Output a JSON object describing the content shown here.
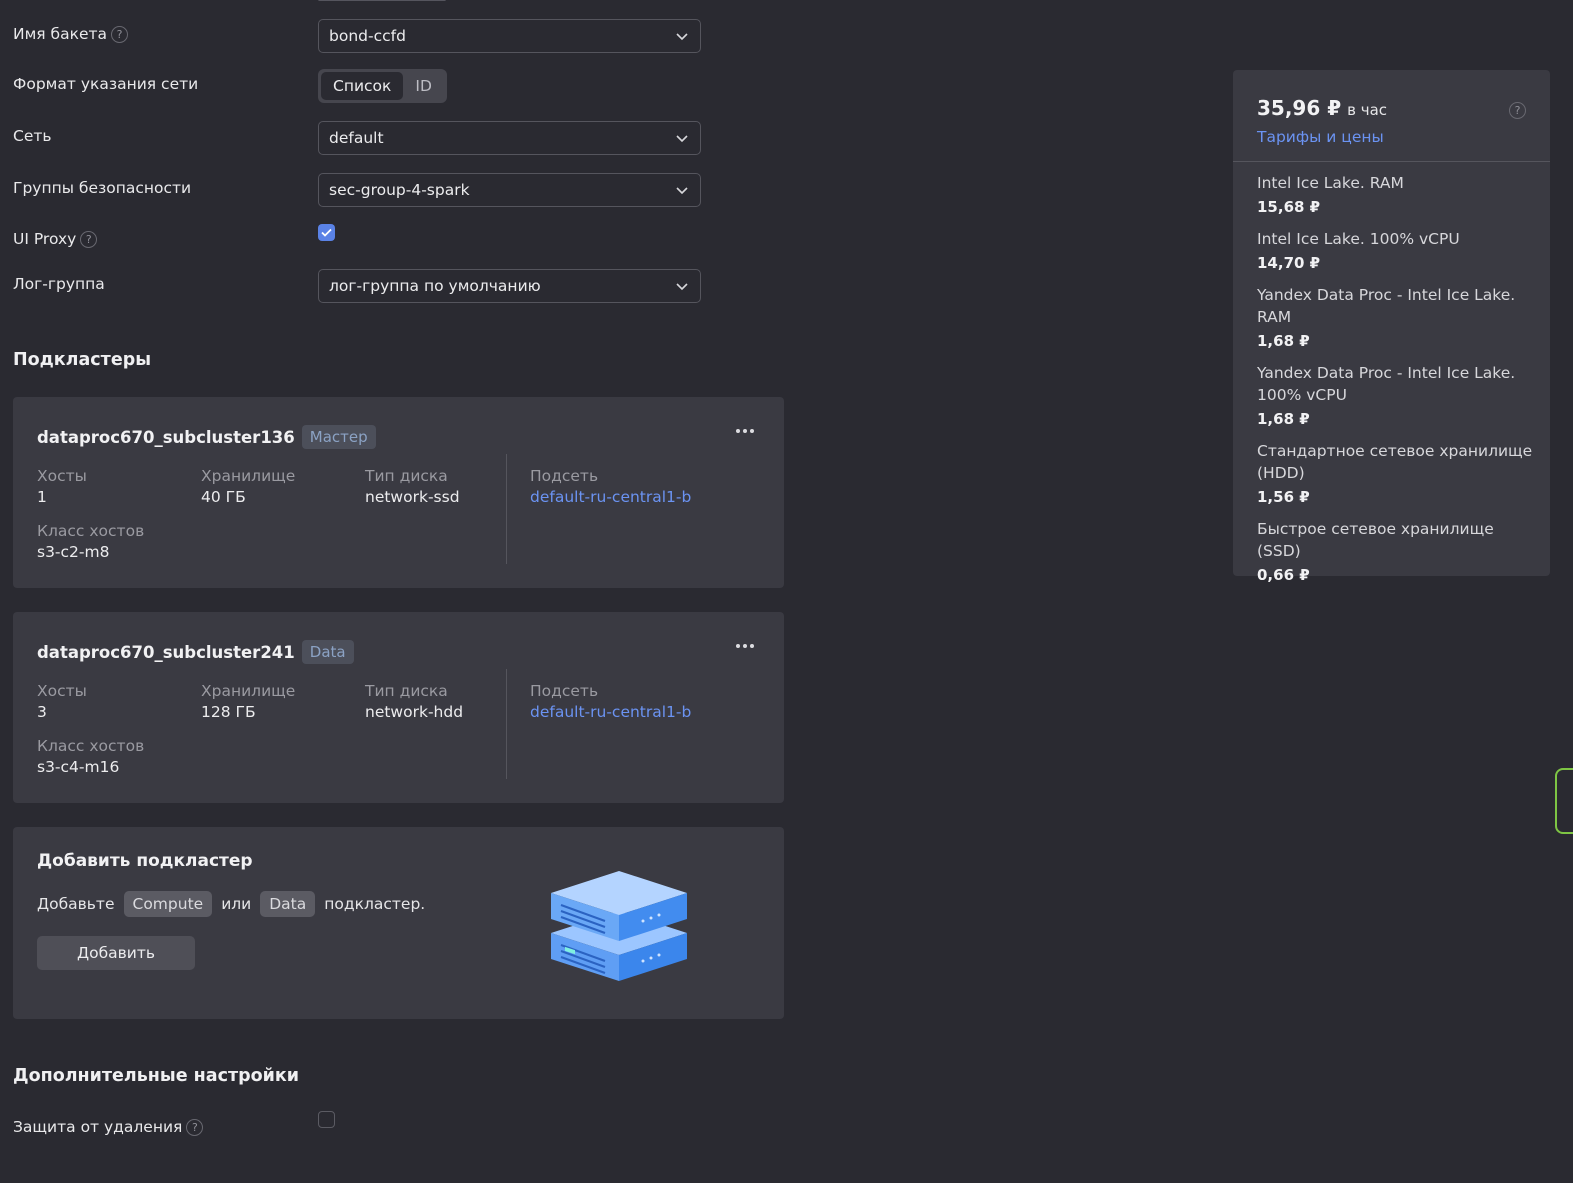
{
  "form": {
    "bucket": {
      "label": "Имя бакета",
      "value": "bond-ccfd"
    },
    "network_format": {
      "label": "Формат указания сети",
      "options": [
        "Список",
        "ID"
      ],
      "selected": "Список"
    },
    "network": {
      "label": "Сеть",
      "value": "default"
    },
    "security_groups": {
      "label": "Группы безопасности",
      "value": "sec-group-4-spark"
    },
    "ui_proxy": {
      "label": "UI Proxy",
      "checked": true
    },
    "log_group": {
      "label": "Лог-группа",
      "value": "лог-группа по умолчанию"
    }
  },
  "subclusters": {
    "title": "Подкластеры",
    "items": [
      {
        "name": "dataproc670_subcluster136",
        "role": "Мастер",
        "hosts_label": "Хосты",
        "hosts": "1",
        "storage_label": "Хранилище",
        "storage": "40 ГБ",
        "disk_label": "Тип диска",
        "disk": "network-ssd",
        "subnet_label": "Подсеть",
        "subnet": "default-ru-central1-b",
        "class_label": "Класс хостов",
        "class": "s3-c2-m8"
      },
      {
        "name": "dataproc670_subcluster241",
        "role": "Data",
        "hosts_label": "Хосты",
        "hosts": "3",
        "storage_label": "Хранилище",
        "storage": "128 ГБ",
        "disk_label": "Тип диска",
        "disk": "network-hdd",
        "subnet_label": "Подсеть",
        "subnet": "default-ru-central1-b",
        "class_label": "Класс хостов",
        "class": "s3-c4-m16"
      }
    ],
    "add": {
      "title": "Добавить подкластер",
      "prefix": "Добавьте",
      "compute": "Compute",
      "or": "или",
      "data": "Data",
      "suffix": "подкластер.",
      "button": "Добавить"
    }
  },
  "additional": {
    "title": "Дополнительные настройки",
    "deletion_protection": {
      "label": "Защита от удаления",
      "checked": false
    }
  },
  "price": {
    "total": "35,96 ₽",
    "unit": "в час",
    "link": "Тарифы и цены",
    "items": [
      {
        "name": "Intel Ice Lake. RAM",
        "price": "15,68 ₽"
      },
      {
        "name": "Intel Ice Lake. 100% vCPU",
        "price": "14,70 ₽"
      },
      {
        "name": "Yandex Data Proc - Intel Ice Lake. RAM",
        "price": "1,68 ₽"
      },
      {
        "name": "Yandex Data Proc - Intel Ice Lake. 100% vCPU",
        "price": "1,68 ₽"
      },
      {
        "name": "Стандартное сетевое хранилище (HDD)",
        "price": "1,56 ₽"
      },
      {
        "name": "Быстрое сетевое хранилище (SSD)",
        "price": "0,66 ₽"
      }
    ]
  },
  "colors": {
    "accent": "#5a82e6",
    "link": "#6b93f2",
    "card": "#3a3a42",
    "background": "#2a2a31"
  },
  "help_glyph": "?"
}
